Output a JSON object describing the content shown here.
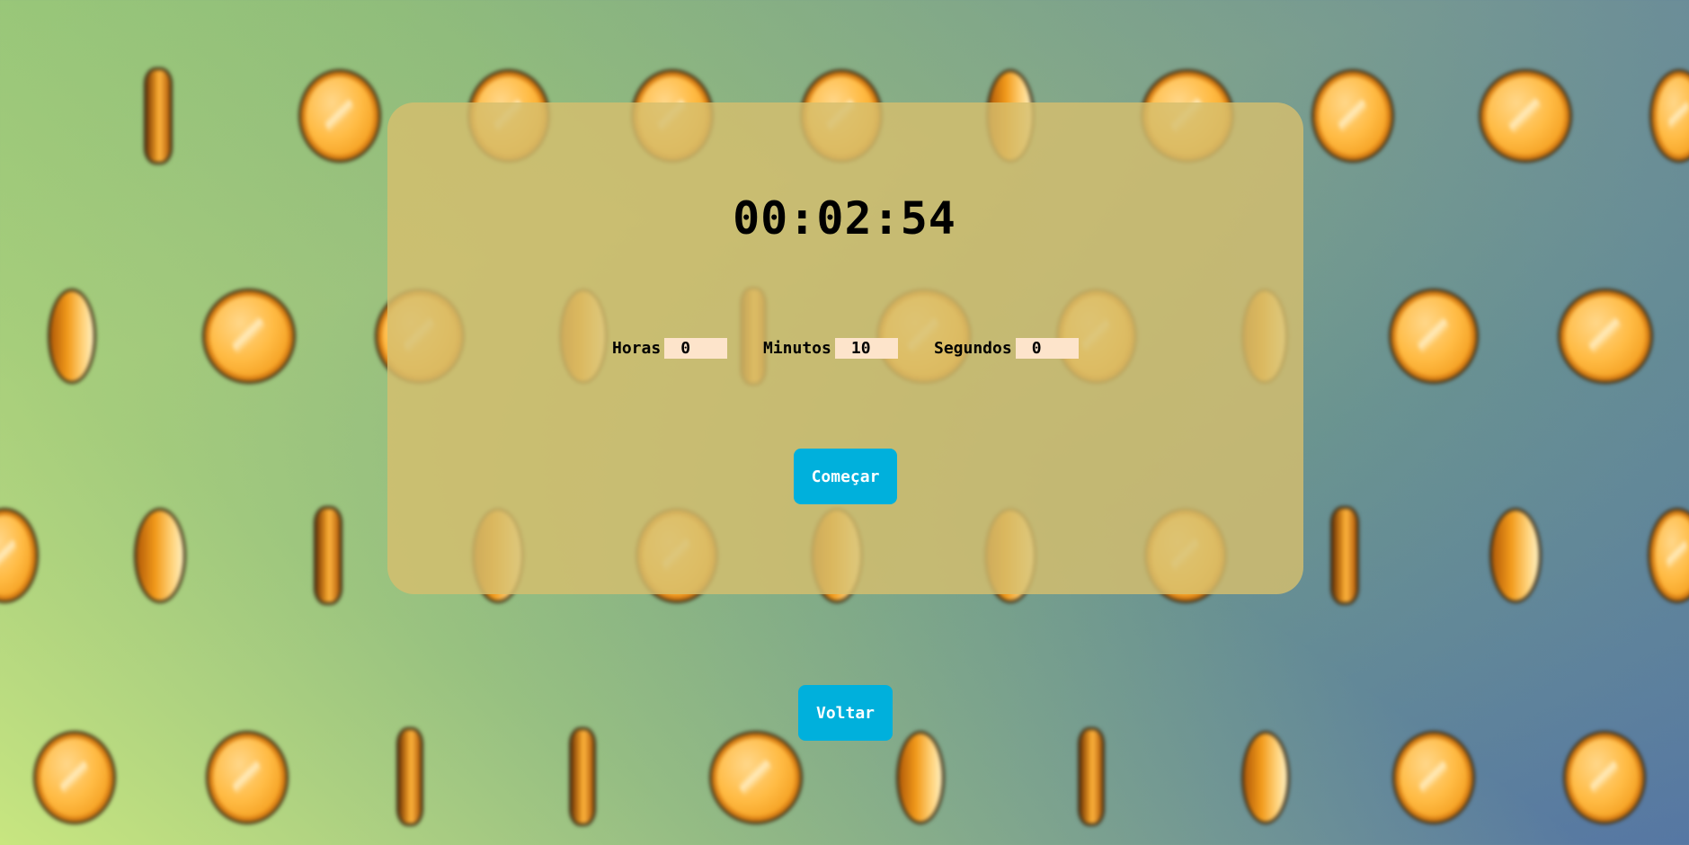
{
  "timer": {
    "display": "00:02:54"
  },
  "fields": {
    "hours": {
      "label": "Horas",
      "value": "0"
    },
    "minutes": {
      "label": "Minutos",
      "value": "10"
    },
    "seconds": {
      "label": "Segundos",
      "value": "0"
    }
  },
  "buttons": {
    "start_label": "Começar",
    "back_label": "Voltar"
  },
  "colors": {
    "button_bg": "#00b0dc",
    "input_bg": "#fde4cb",
    "panel_bg": "#d5be6e"
  },
  "background": {
    "icon": "gold-coin-pattern"
  }
}
